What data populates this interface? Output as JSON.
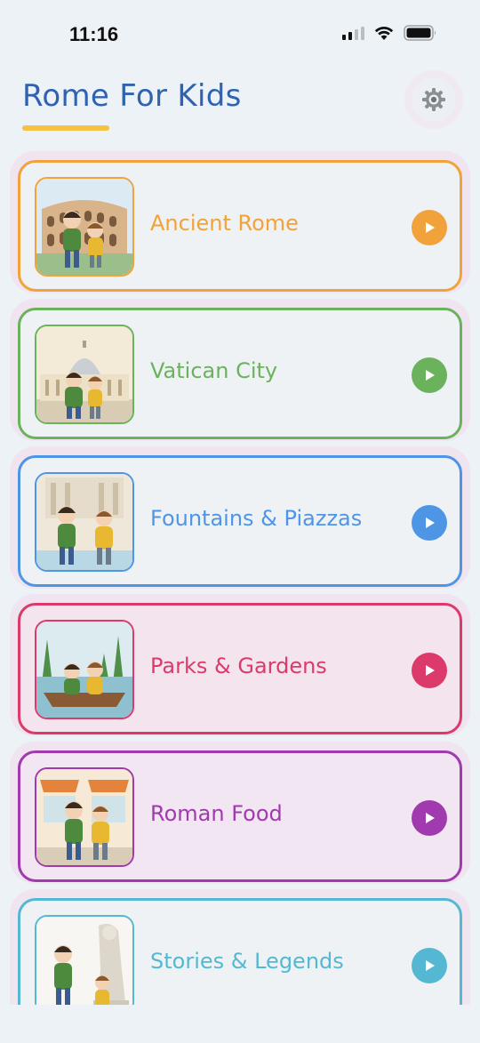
{
  "status_bar": {
    "time": "11:16"
  },
  "header": {
    "title": "Rome For Kids",
    "title_color": "#2f63b2",
    "underline_color": "#f7c244"
  },
  "topics": [
    {
      "label": "Ancient Rome",
      "color": "#f2a23a",
      "bg": "#eef2f5",
      "scene": "colosseum"
    },
    {
      "label": "Vatican City",
      "color": "#6ab25c",
      "bg": "#eef2f5",
      "scene": "vatican"
    },
    {
      "label": "Fountains & Piazzas",
      "color": "#4f95e6",
      "bg": "#eef2f5",
      "scene": "fountain"
    },
    {
      "label": "Parks & Gardens",
      "color": "#dc3a6a",
      "bg": "#f3e4ee",
      "scene": "lake"
    },
    {
      "label": "Roman Food",
      "color": "#a03aae",
      "bg": "#f1e6f1",
      "scene": "shop"
    },
    {
      "label": "Stories & Legends",
      "color": "#54b8d2",
      "bg": "#eef2f5",
      "scene": "statue"
    }
  ]
}
